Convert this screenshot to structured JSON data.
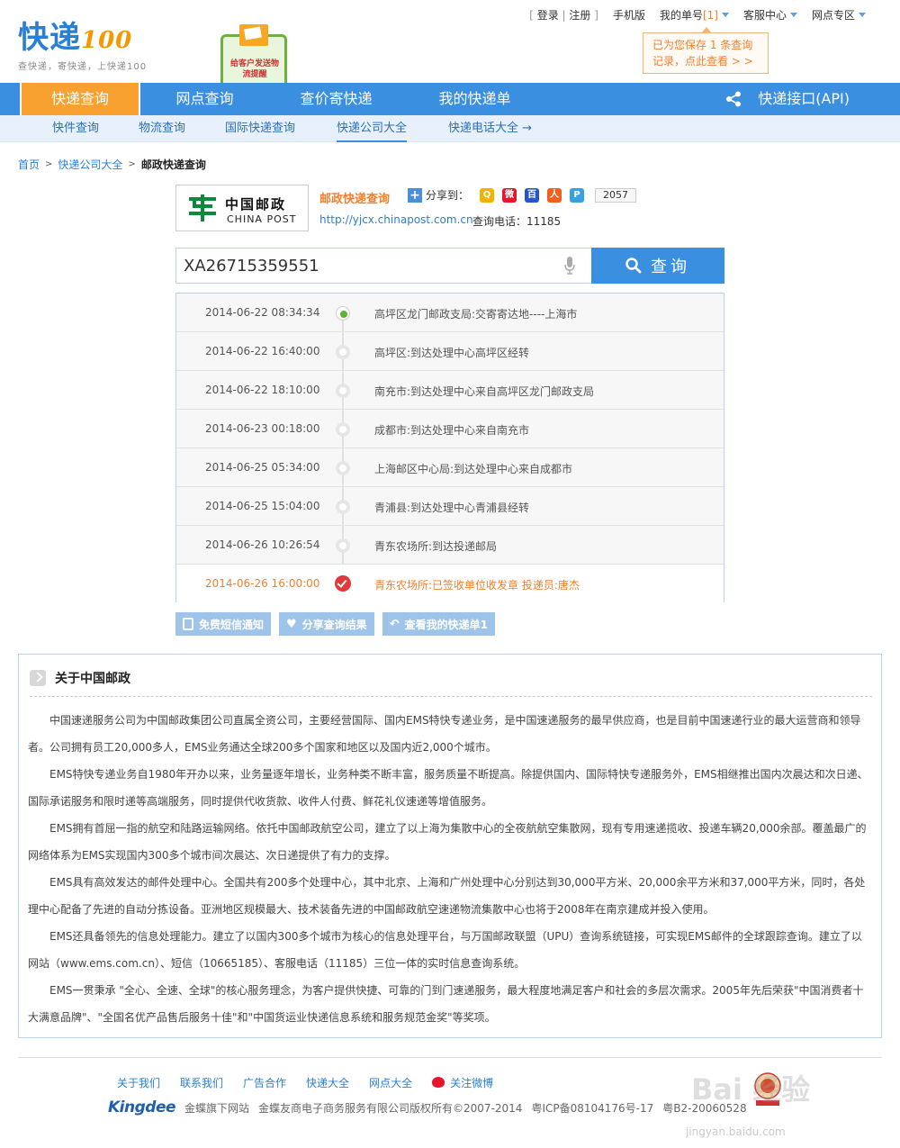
{
  "header": {
    "logo_main": "快递",
    "logo_num": "100",
    "logo_slogan": "查快递，寄快递，上快递100",
    "promo_text": "给客户发送物流提醒",
    "topnav": {
      "login": "登录",
      "register": "注册",
      "mobile": "手机版",
      "my_orders": "我的单号",
      "my_orders_count": "[1]",
      "service": "客服中心",
      "outlets": "网点专区"
    },
    "saved_tip": "已为您保存 1 条查询记录，点此查看 > >"
  },
  "mainnav": {
    "tabs": [
      "快递查询",
      "网点查询",
      "查价寄快递",
      "我的快递单"
    ],
    "api": "快递接口(API)"
  },
  "subnav": [
    "快件查询",
    "物流查询",
    "国际快递查询",
    "快递公司大全",
    "快递电话大全 →"
  ],
  "breadcrumb": {
    "home": "首页",
    "section": "快递公司大全",
    "current": "邮政快递查询"
  },
  "company": {
    "logo_cn": "中国邮政",
    "logo_en": "CHINA POST",
    "name": "邮政快递查询",
    "share_label": "分享到：",
    "share_count": "2057",
    "url": "http://yjcx.chinapost.com.cn",
    "phone": "查询电话：11185"
  },
  "search": {
    "value": "XA26715359551",
    "button": "查询"
  },
  "tracking": [
    {
      "time": "2014-06-22 08:34:34",
      "context": "高坪区龙门邮政支局:交寄寄达地----上海市"
    },
    {
      "time": "2014-06-22 16:40:00",
      "context": "高坪区:到达处理中心高坪区经转"
    },
    {
      "time": "2014-06-22 18:10:00",
      "context": "南充市:到达处理中心来自高坪区龙门邮政支局"
    },
    {
      "time": "2014-06-23 00:18:00",
      "context": "成都市:到达处理中心来自南充市"
    },
    {
      "time": "2014-06-25 05:34:00",
      "context": "上海邮区中心局:到达处理中心来自成都市"
    },
    {
      "time": "2014-06-25 15:04:00",
      "context": "青浦县:到达处理中心青浦县经转"
    },
    {
      "time": "2014-06-26 10:26:54",
      "context": "青东农场所:到达投递邮局"
    },
    {
      "time": "2014-06-26 16:00:00",
      "context": "青东农场所:已签收单位收发章 投递员:唐杰"
    }
  ],
  "actions": [
    "免费短信通知",
    "分享查询结果",
    "查看我的快递单1"
  ],
  "about": {
    "title": "关于中国邮政",
    "paragraphs": [
      "中国速递服务公司为中国邮政集团公司直属全资公司，主要经营国际、国内EMS特快专递业务，是中国速递服务的最早供应商，也是目前中国速递行业的最大运营商和领导者。公司拥有员工20,000多人，EMS业务通达全球200多个国家和地区以及国内近2,000个城市。",
      "EMS特快专递业务自1980年开办以来，业务量逐年增长，业务种类不断丰富，服务质量不断提高。除提供国内、国际特快专递服务外，EMS相继推出国内次晨达和次日递、国际承诺服务和限时递等高端服务，同时提供代收货款、收件人付费、鲜花礼仪速递等增值服务。",
      "EMS拥有首屈一指的航空和陆路运输网络。依托中国邮政航空公司，建立了以上海为集散中心的全夜航航空集散网，现有专用速递揽收、投递车辆20,000余部。覆盖最广的网络体系为EMS实现国内300多个城市间次晨达、次日递提供了有力的支撑。",
      "EMS具有高效发达的邮件处理中心。全国共有200多个处理中心，其中北京、上海和广州处理中心分别达到30,000平方米、20,000余平方米和37,000平方米，同时，各处理中心配备了先进的自动分拣设备。亚洲地区规模最大、技术装备先进的中国邮政航空速递物流集散中心也将于2008年在南京建成并投入使用。",
      "EMS还具备领先的信息处理能力。建立了以国内300多个城市为核心的信息处理平台，与万国邮政联盟（UPU）查询系统链接，可实现EMS邮件的全球跟踪查询。建立了以网站（www.ems.com.cn）、短信（10665185）、客服电话（11185）三位一体的实时信息查询系统。",
      "EMS一贯秉承 \"全心、全速、全球\"的核心服务理念，为客户提供快捷、可靠的门到门速递服务，最大程度地满足客户和社会的多层次需求。2005年先后荣获\"中国消费者十大满意品牌\"、\"全国名优产品售后服务十佳\"和\"中国货运业快递信息系统和服务规范金奖\"等奖项。"
    ]
  },
  "footer": {
    "links": [
      "关于我们",
      "联系我们",
      "广告合作",
      "快递大全",
      "网点大全",
      "关注微博"
    ],
    "brand": "Kingdee",
    "brand_tag": "金蝶旗下网站",
    "copyright": "金蝶友商电子商务服务有限公司版权所有©2007-2014",
    "icp": "粤ICP备08104176号-17",
    "icp2": "粤B2-20060528"
  },
  "watermark": {
    "text": "Bai 经验",
    "url": "jingyan.baidu.com"
  }
}
